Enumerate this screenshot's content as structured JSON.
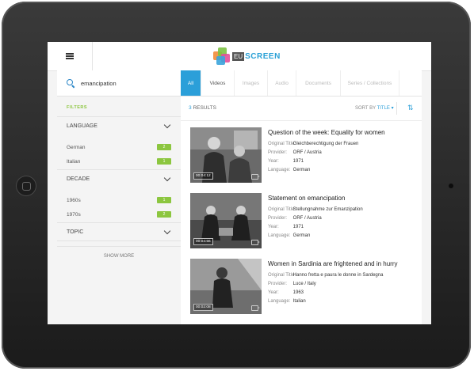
{
  "app": {
    "logo_text": "SCREEN",
    "logo_prefix": "EU"
  },
  "search": {
    "value": "emancipation"
  },
  "filters": {
    "title": "FILTERS",
    "language": {
      "label": "LANGUAGE",
      "items": [
        {
          "label": "German",
          "count": "2"
        },
        {
          "label": "Italian",
          "count": "1"
        }
      ]
    },
    "decade": {
      "label": "DECADE",
      "items": [
        {
          "label": "1960s",
          "count": "1"
        },
        {
          "label": "1970s",
          "count": "2"
        }
      ]
    },
    "topic": {
      "label": "TOPIC"
    },
    "show_more": "SHOW MORE"
  },
  "tabs": [
    {
      "label": "All"
    },
    {
      "label": "Videos"
    },
    {
      "label": "Images"
    },
    {
      "label": "Audio"
    },
    {
      "label": "Documents"
    },
    {
      "label": "Series / Collections"
    }
  ],
  "results": {
    "count": "3",
    "count_label": "RESULTS",
    "sort_label": "SORT BY",
    "sort_value": "TITLE",
    "meta_keys": {
      "original_title": "Original Title:",
      "provider": "Provider:",
      "year": "Year:",
      "language": "Language:"
    },
    "items": [
      {
        "title": "Question of the week: Equality for women",
        "original_title": "Gleichberechtigung der Frauen",
        "provider": "ORF / Austria",
        "year": "1971",
        "language": "German",
        "duration": "00:04:12"
      },
      {
        "title": "Statement on emancipation",
        "original_title": "Stellungnahme zur Emanzipation",
        "provider": "ORF / Austria",
        "year": "1971",
        "language": "German",
        "duration": "00:04:56"
      },
      {
        "title": "Women in Sardinia are frightened and in hurry",
        "original_title": "Hanno fretta e paura le donne in Sardegna",
        "provider": "Luce / Italy",
        "year": "1963",
        "language": "Italian",
        "duration": "00:02:08"
      }
    ]
  },
  "colors": {
    "accent_blue": "#2b9fd9",
    "accent_green": "#8cc63f"
  }
}
